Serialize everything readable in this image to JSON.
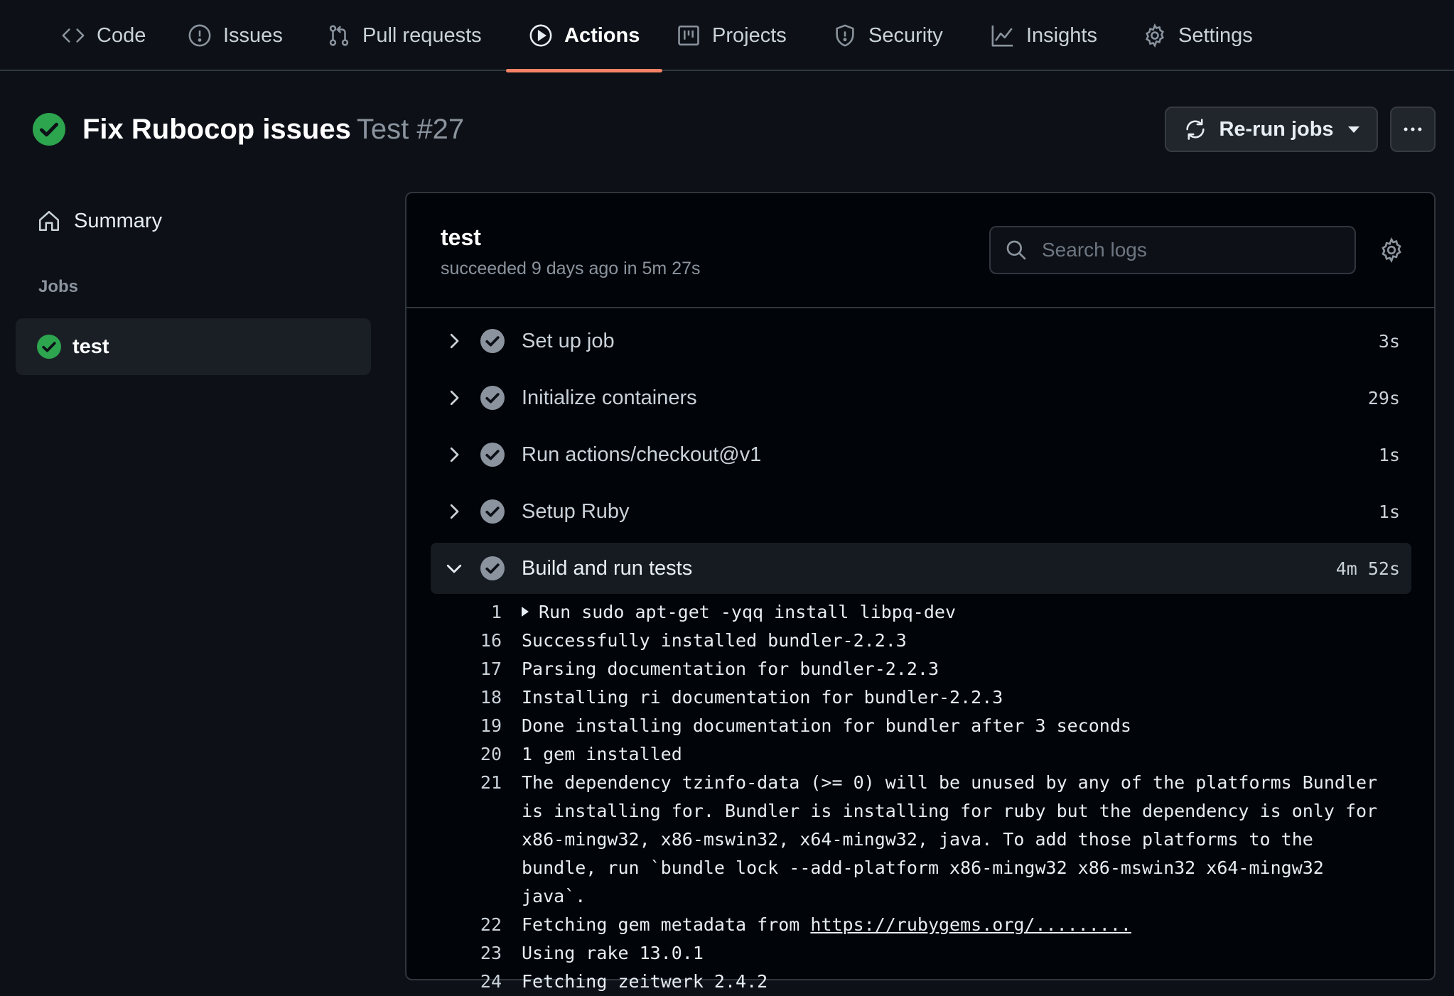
{
  "nav": {
    "tabs": [
      {
        "label": "Code",
        "icon": "code-icon"
      },
      {
        "label": "Issues",
        "icon": "issue-opened-icon"
      },
      {
        "label": "Pull requests",
        "icon": "pull-request-icon"
      },
      {
        "label": "Actions",
        "icon": "play-icon",
        "active": true
      },
      {
        "label": "Projects",
        "icon": "project-icon"
      },
      {
        "label": "Security",
        "icon": "shield-icon"
      },
      {
        "label": "Insights",
        "icon": "graph-icon"
      },
      {
        "label": "Settings",
        "icon": "gear-icon"
      }
    ]
  },
  "run": {
    "title": "Fix Rubocop issues",
    "subtitle": "Test #27",
    "status": "success",
    "rerun_label": "Re-run jobs"
  },
  "sidebar": {
    "summary_label": "Summary",
    "jobs_heading": "Jobs",
    "jobs": [
      {
        "label": "test",
        "status": "success"
      }
    ]
  },
  "job": {
    "name": "test",
    "meta": "succeeded 9 days ago in 5m 27s",
    "search_placeholder": "Search logs",
    "steps": [
      {
        "name": "Set up job",
        "duration": "3s"
      },
      {
        "name": "Initialize containers",
        "duration": "29s"
      },
      {
        "name": "Run actions/checkout@v1",
        "duration": "1s"
      },
      {
        "name": "Setup Ruby",
        "duration": "1s"
      },
      {
        "name": "Build and run tests",
        "duration": "4m 52s",
        "expanded": true
      }
    ],
    "log": [
      {
        "n": "1",
        "text": "Run sudo apt-get -yqq install libpq-dev"
      },
      {
        "n": "16",
        "text": "Successfully installed bundler-2.2.3"
      },
      {
        "n": "17",
        "text": "Parsing documentation for bundler-2.2.3"
      },
      {
        "n": "18",
        "text": "Installing ri documentation for bundler-2.2.3"
      },
      {
        "n": "19",
        "text": "Done installing documentation for bundler after 3 seconds"
      },
      {
        "n": "20",
        "text": "1 gem installed"
      },
      {
        "n": "21",
        "text": "The dependency tzinfo-data (>= 0) will be unused by any of the platforms Bundler is installing for. Bundler is installing for ruby but the dependency is only for x86-mingw32, x86-mswin32, x64-mingw32, java. To add those platforms to the bundle, run `bundle lock --add-platform x86-mingw32 x86-mswin32 x64-mingw32 java`."
      },
      {
        "n": "22",
        "text": "Fetching gem metadata from ",
        "link": "https://rubygems.org/........."
      },
      {
        "n": "23",
        "text": "Using rake 13.0.1"
      },
      {
        "n": "24",
        "text": "Fetching zeitwerk 2.4.2"
      }
    ]
  },
  "colors": {
    "success": "#2da44e",
    "active_tab_underline": "#f78166",
    "background": "#0d1117"
  }
}
